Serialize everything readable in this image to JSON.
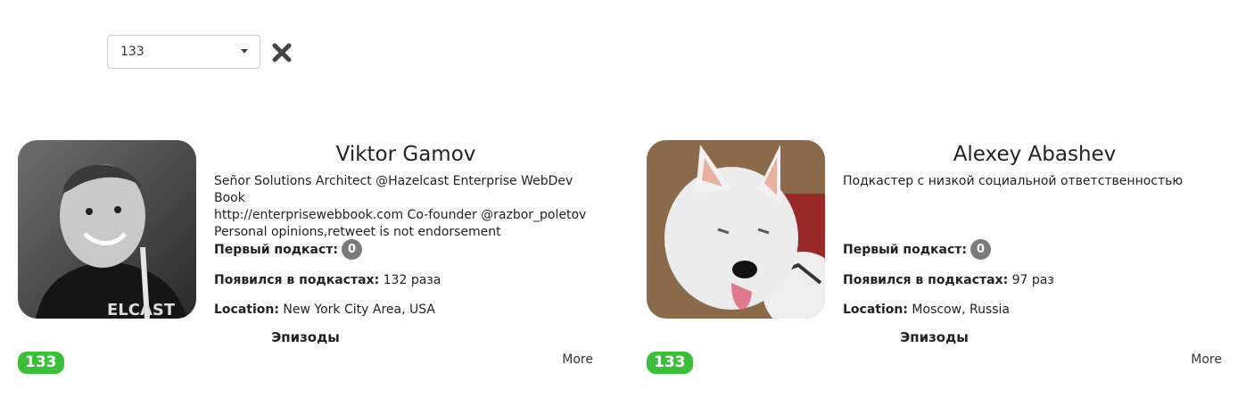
{
  "filter": {
    "selected_value": "133"
  },
  "cards": [
    {
      "name": "Viktor Gamov",
      "bio_lines": [
        "Señor Solutions Architect @Hazelcast Enterprise WebDev Book",
        "http://enterprisewebbook.com  Co-founder @razbor_poletov",
        "Personal opinions,retweet is not endorsement"
      ],
      "first_podcast_label": "Первый подкаст:",
      "first_podcast_value": "0",
      "appeared_label": "Появился в подкастах:",
      "appeared_value": "132 раза",
      "location_label": "Location:",
      "location_value": "New York City Area, USA",
      "episodes_label": "Эпизоды",
      "episode_badge": "133",
      "more_label": "More"
    },
    {
      "name": "Alexey Abashev",
      "bio_lines": [
        "Подкастер с низкой социальной ответственностью"
      ],
      "first_podcast_label": "Первый подкаст:",
      "first_podcast_value": "0",
      "appeared_label": "Появился в подкастах:",
      "appeared_value": "97 раз",
      "location_label": "Location:",
      "location_value": "Moscow, Russia",
      "episodes_label": "Эпизоды",
      "episode_badge": "133",
      "more_label": "More"
    }
  ]
}
